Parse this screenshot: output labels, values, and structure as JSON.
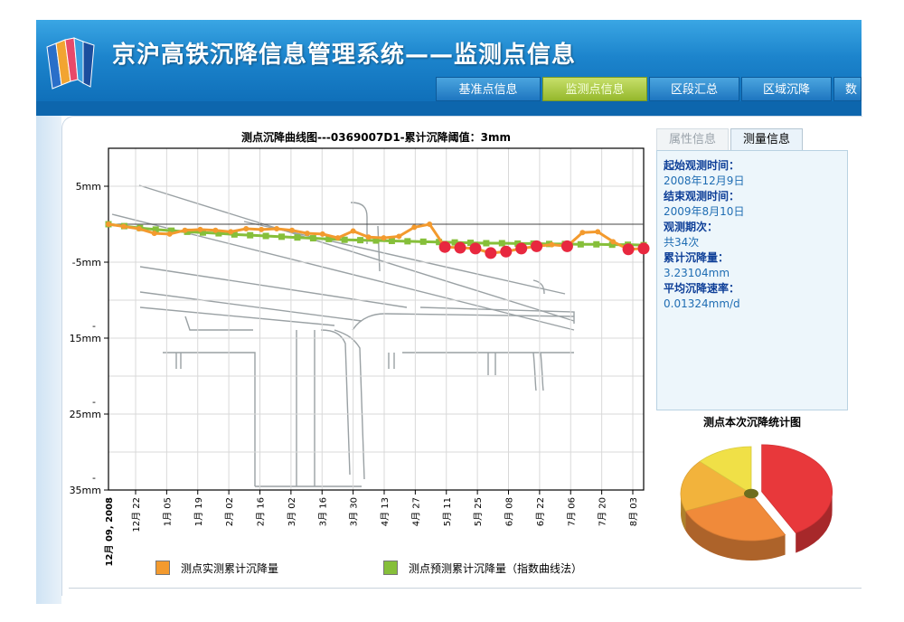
{
  "header": {
    "title": "京沪高铁沉降信息管理系统——监测点信息",
    "tabs": [
      {
        "label": "基准点信息",
        "active": false
      },
      {
        "label": "监测点信息",
        "active": true
      },
      {
        "label": "区段汇总",
        "active": false
      },
      {
        "label": "区域沉降",
        "active": false
      },
      {
        "label": "数",
        "active": false
      }
    ]
  },
  "info": {
    "tabs": [
      "属性信息",
      "测量信息"
    ],
    "active_tab": "测量信息",
    "fields": [
      {
        "label": "起始观测时间：",
        "value": "2008年12月9日"
      },
      {
        "label": "结束观测时间：",
        "value": "2009年8月10日"
      },
      {
        "label": "观测期次：",
        "value": "共34次"
      },
      {
        "label": "累计沉降量：",
        "value": "3.23104mm"
      },
      {
        "label": "平均沉降速率：",
        "value": "0.01324mm/d"
      }
    ]
  },
  "pie": {
    "title": "测点本次沉降统计图",
    "colors": [
      "#e8383b",
      "#f08a3a",
      "#f2b33c",
      "#f0e047"
    ],
    "values": [
      0.42,
      0.27,
      0.18,
      0.13
    ]
  },
  "chart_data": {
    "type": "line",
    "title": "测点沉降曲线图---0369007D1-累计沉降阈值：3mm",
    "y_tick_labels": [
      "5mm",
      "-5mm",
      "-\n15mm",
      "-\n25mm",
      "-\n35mm"
    ],
    "y_ticks": [
      5,
      -5,
      -15,
      -25,
      -35
    ],
    "ylim": [
      -35,
      10
    ],
    "threshold": 0,
    "x_first_label": "12月 09, 2008",
    "x_tick_labels": [
      "12月 22",
      "1月 05",
      "1月 19",
      "2月 02",
      "2月 16",
      "3月 02",
      "3月 16",
      "3月 30",
      "4月 13",
      "4月 27",
      "5月 11",
      "5月 25",
      "6月 08",
      "6月 22",
      "7月 06",
      "7月 20",
      "8月 03"
    ],
    "series": [
      {
        "name": "测点实测累计沉降量",
        "color": "#f39a2e",
        "y": [
          0,
          -0.3,
          -0.6,
          -1.2,
          -1.3,
          -0.8,
          -0.7,
          -0.8,
          -1.0,
          -0.6,
          -0.7,
          -0.6,
          -0.8,
          -1.2,
          -1.3,
          -1.8,
          -0.9,
          -1.7,
          -1.8,
          -1.6,
          -0.4,
          0,
          -3.0,
          -3.1,
          -3.2,
          -3.8,
          -3.6,
          -3.2,
          -2.9,
          -2.7,
          -2.9,
          -1.1,
          -1.0,
          -2.3,
          -3.3,
          -3.2
        ],
        "exceed_color": "#e8283f"
      },
      {
        "name": "测点预测累计沉降量（指数曲线法）",
        "color": "#86bf3a",
        "y": [
          0,
          -0.25,
          -0.5,
          -0.7,
          -0.85,
          -1.0,
          -1.1,
          -1.2,
          -1.35,
          -1.45,
          -1.55,
          -1.65,
          -1.75,
          -1.85,
          -1.95,
          -2.05,
          -2.1,
          -2.15,
          -2.2,
          -2.25,
          -2.3,
          -2.35,
          -2.4,
          -2.45,
          -2.5,
          -2.5,
          -2.55,
          -2.55,
          -2.6,
          -2.6,
          -2.65,
          -2.65,
          -2.7,
          -2.7,
          -2.75
        ]
      }
    ],
    "legend_position": "bottom",
    "grid": true
  }
}
